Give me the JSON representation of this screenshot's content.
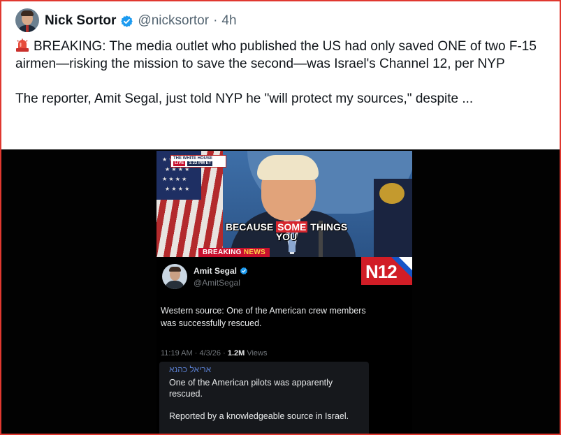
{
  "tweet": {
    "author_name": "Nick Sortor",
    "handle": "@nicksortor",
    "separator": "·",
    "age": "4h",
    "icon": "siren-emoji-icon",
    "paragraph1": "BREAKING: The media outlet who published the US had only saved ONE of two F-15 airmen—risking the mission to save the second—was Israel's Channel 12, per NYP",
    "paragraph2": "The reporter, Amit Segal, just told NYP he \"will protect my sources,\" despite ..."
  },
  "video": {
    "badge_title": "THE WHITE HOUSE",
    "badge_live": "LIVE",
    "badge_time": "1:22 PM ET",
    "caption_before": "BECAUSE ",
    "caption_highlight": "SOME",
    "caption_after": " THINGS",
    "caption_line2": "YOU",
    "breaking_label": "BREAKING ",
    "breaking_news": "NEWS"
  },
  "embedded_tweet": {
    "author_name": "Amit Segal",
    "handle": "@AmitSegal",
    "logo_text": "N12",
    "body": "Western source: One of the American crew members was successfully rescued.",
    "time": "11:19 AM",
    "date": "4/3/26",
    "meta_sep": " · ",
    "views_count": "1.2M",
    "views_label": " Views",
    "quote": {
      "author": "אריאל כהנא",
      "line1": "One of the American pilots was apparently rescued.",
      "line2": "Reported by a knowledgeable source in Israel."
    }
  },
  "colors": {
    "frame_border": "#e0382f",
    "verified_blue": "#1d9bf0",
    "breaking_red": "#c8102e",
    "n12_red": "#d11d26"
  }
}
